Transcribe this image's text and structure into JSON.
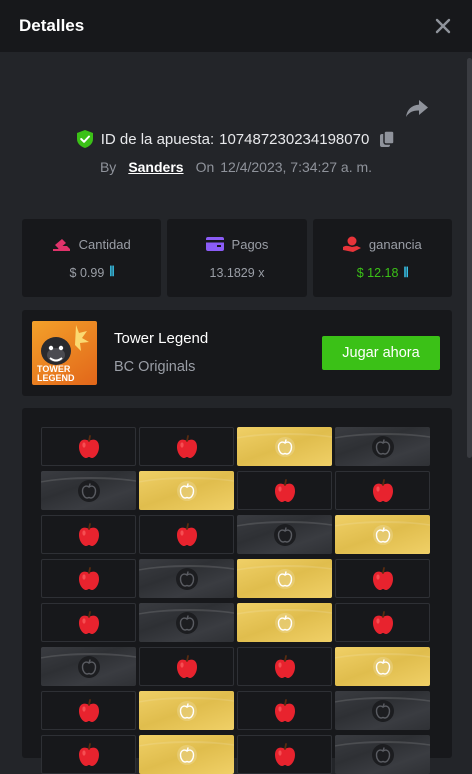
{
  "header": {
    "title": "Detalles"
  },
  "bet": {
    "id_label": "ID de la apuesta:",
    "id_value": "107487230234198070",
    "by_label": "By",
    "user": "Sanders",
    "on_label": "On",
    "datetime": "12/4/2023, 7:34:27 a. m."
  },
  "stats": [
    {
      "label": "Cantidad",
      "value": "$ 0.99",
      "icon": "bet-amount-icon",
      "accent": "#e0336b"
    },
    {
      "label": "Pagos",
      "value": "13.1829 x",
      "icon": "payout-card-icon",
      "accent": "#8b5cf6"
    },
    {
      "label": "ganancia",
      "value": "$ 12.18",
      "icon": "profit-icon",
      "accent": "#e8343a"
    }
  ],
  "coin_symbol": "ꟾꟾ",
  "game": {
    "name": "Tower Legend",
    "provider": "BC Originals",
    "play_label": "Jugar ahora",
    "thumb_text_1": "TOWER",
    "thumb_text_2": "LEGEND"
  },
  "colors": {
    "accent_green": "#3bc117",
    "background": "#232529",
    "panel": "#17181b",
    "gold": "#e9c95c"
  },
  "board": [
    [
      "apple",
      "apple",
      "gold",
      "dark"
    ],
    [
      "dark",
      "gold",
      "apple",
      "apple"
    ],
    [
      "apple",
      "apple",
      "dark",
      "gold"
    ],
    [
      "apple",
      "dark",
      "gold",
      "apple"
    ],
    [
      "apple",
      "dark",
      "gold",
      "apple"
    ],
    [
      "dark",
      "apple",
      "apple",
      "gold"
    ],
    [
      "apple",
      "gold",
      "apple",
      "dark"
    ],
    [
      "apple",
      "gold",
      "apple",
      "dark"
    ]
  ]
}
